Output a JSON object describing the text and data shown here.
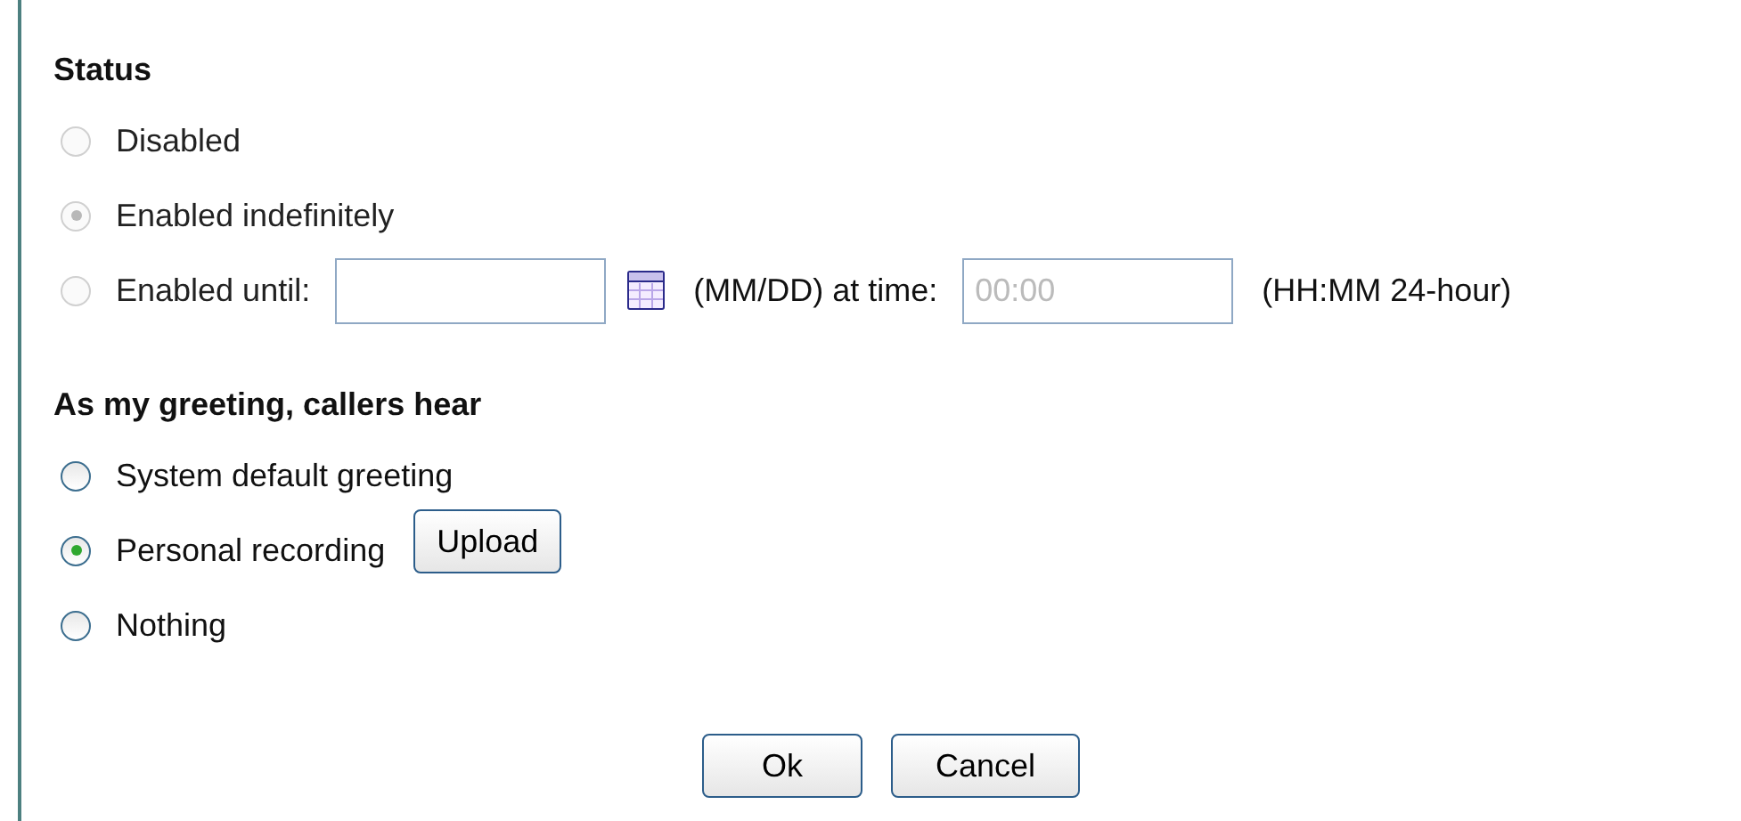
{
  "status": {
    "heading": "Status",
    "options": [
      {
        "kind": "plain",
        "label": "Disabled",
        "selected": false,
        "disabled": true
      },
      {
        "kind": "plain",
        "label": "Enabled indefinitely",
        "selected": true,
        "disabled": true
      },
      {
        "kind": "until",
        "label": "Enabled until:",
        "selected": false,
        "disabled": true,
        "date_hint": "(MM/DD) at time:",
        "time_placeholder": "00:00",
        "time_hint": "(HH:MM 24-hour)"
      }
    ]
  },
  "greeting": {
    "heading": "As my greeting, callers hear",
    "options": [
      {
        "kind": "plain",
        "label": "System default greeting",
        "selected": false,
        "disabled": false
      },
      {
        "kind": "upload",
        "label": "Personal recording",
        "selected": true,
        "disabled": false,
        "button": "Upload"
      },
      {
        "kind": "plain",
        "label": "Nothing",
        "selected": false,
        "disabled": false
      }
    ]
  },
  "buttons": [
    "Ok",
    "Cancel"
  ]
}
